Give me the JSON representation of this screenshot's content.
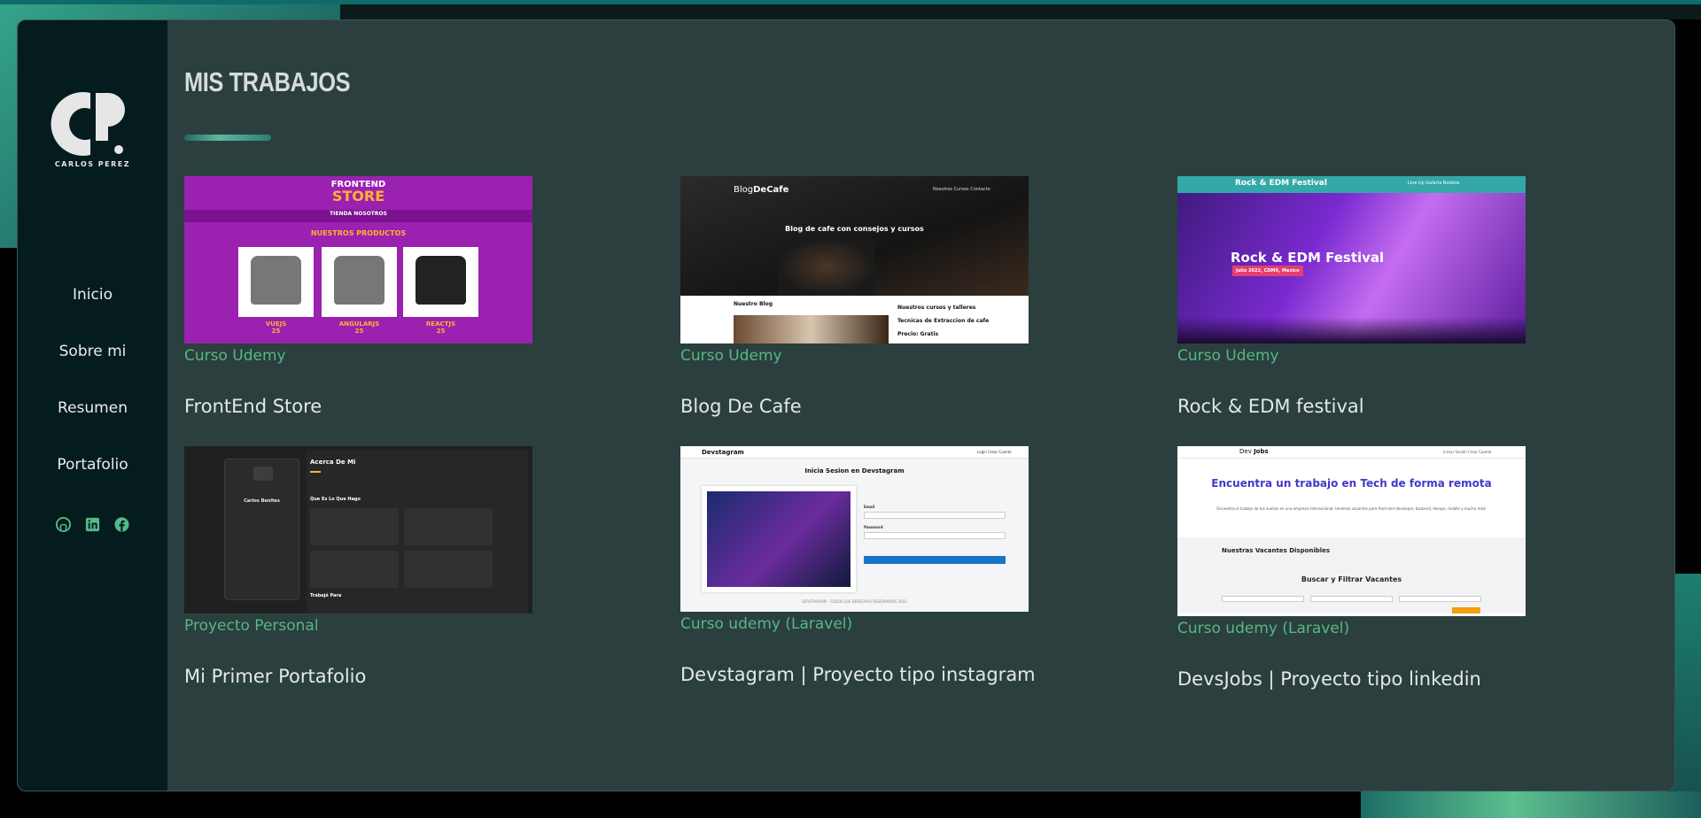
{
  "colors": {
    "background": "#2b3f3e",
    "sidebar": "#041c1d",
    "accent_green": "#55b886",
    "title_text": "#d6dcdc"
  },
  "sidebar": {
    "logo_name": "CARLOS PEREZ",
    "nav": [
      {
        "label": "Inicio"
      },
      {
        "label": "Sobre mi"
      },
      {
        "label": "Resumen"
      },
      {
        "label": "Portafolio"
      }
    ],
    "social": [
      "github-icon",
      "linkedin-icon",
      "facebook-icon"
    ]
  },
  "main": {
    "title": "MIS TRABAJOS",
    "projects": [
      {
        "subtitle": "Curso Udemy",
        "title": "FrontEnd Store",
        "thumb": {
          "logo_top": "FRONTEND",
          "logo_bottom": "STORE",
          "nav": "TIENDA   NOSOTROS",
          "heading": "NUESTROS PRODUCTOS",
          "items": [
            {
              "name": "VUEJS",
              "price": "25"
            },
            {
              "name": "ANGULARJS",
              "price": "25"
            },
            {
              "name": "REACTJS",
              "price": "25"
            }
          ]
        }
      },
      {
        "subtitle": "Curso Udemy",
        "title": "Blog De Cafe",
        "thumb": {
          "brand_a": "Blog",
          "brand_b": "DeCafe",
          "menu": "Nosotros   Cursos   Contacto",
          "slogan": "Blog de cafe con consejos y cursos",
          "left_heading": "Nuestro Blog",
          "right_lines": [
            "Nuestros cursos y talleres",
            "Tecnicas de Extraccion de cafe",
            "Precio: Gratis"
          ]
        }
      },
      {
        "subtitle": "Curso Udemy",
        "title": "Rock & EDM festival",
        "thumb": {
          "top_name": "Rock & EDM Festival",
          "menu": "Line Up   Galeria   Boletos",
          "heading": "Rock & EDM Festival",
          "tag": "Julio 2022, CDMX, Mexico"
        }
      },
      {
        "subtitle": "Proyecto Personal",
        "title": "Mi Primer Portafolio",
        "thumb": {
          "name": "Carlos Benites",
          "heading": "Acerca De Mi",
          "section": "Que Es Lo Que Hago",
          "section2": "Trabajé Para"
        }
      },
      {
        "subtitle": "Curso udemy (Laravel)",
        "title": "Devstagram | Proyecto tipo instagram",
        "thumb": {
          "brand": "Devstagram",
          "menu": "Login   Crear Cuenta",
          "heading": "Inicia Sesion en Devstagram",
          "labels": [
            "Email",
            "Password"
          ],
          "footer": "DEVSTAGRAM - TODOS LOS DERECHOS RESERVADOS 2022"
        }
      },
      {
        "subtitle": "Curso udemy (Laravel)",
        "title": "DevsJobs | Proyecto tipo linkedin",
        "thumb": {
          "brand_a": "Dev",
          "brand_b": "Jobs",
          "menu": "Iniciar Sesión   Crear Cuenta",
          "heading": "Encuentra un trabajo en Tech de forma remota",
          "text": "Encuentra el trabajo de tus sueños en una empresa internacional; tenemos vacantes para front-end developer, backend, devops, mobile y mucho más!",
          "vacantes": "Nuestras Vacantes Disponibles",
          "filter": "Buscar y Filtrar Vacantes"
        }
      }
    ]
  }
}
